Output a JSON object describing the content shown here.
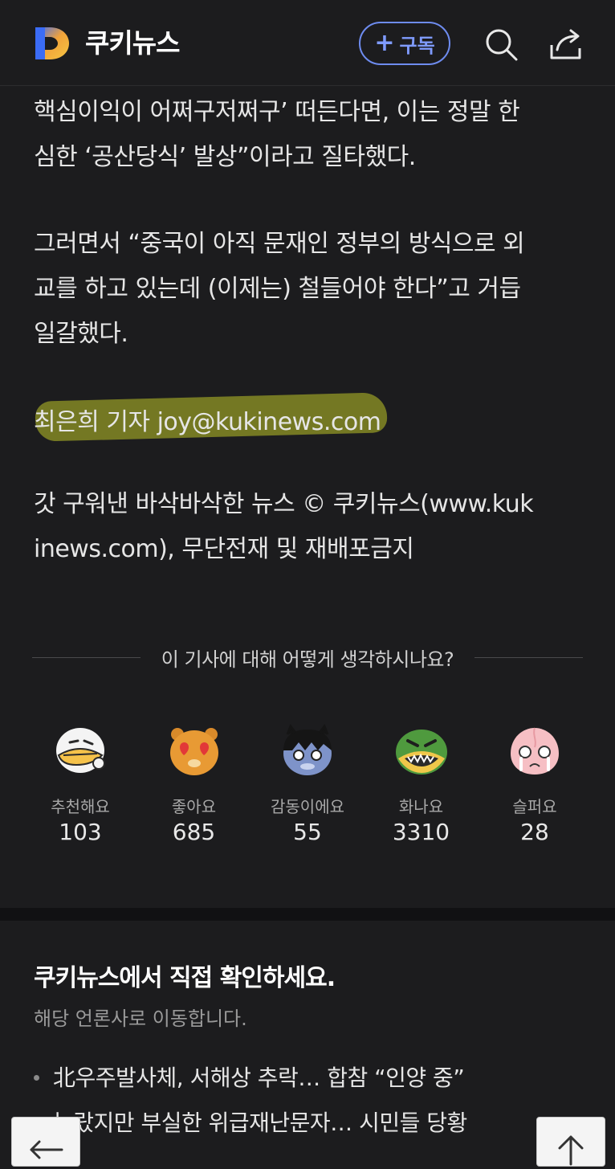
{
  "header": {
    "brand": "쿠키뉴스",
    "subscribe_label": "구독",
    "subscribe_plus": "+"
  },
  "article": {
    "paragraphs": [
      [
        "핵심이익이 어쩌구저쩌구’ 떠든다면, 이는 정말 한",
        "심한 ‘공산당식’ 발상”이라고 질타했다."
      ],
      [
        "그러면서 “중국이 아직 문재인 정부의 방식으로 외",
        "교를 하고 있는데 (이제는) 철들어야 한다”고 거듭",
        "일갈했다."
      ],
      [
        "최은희 기자 joy@kukinews.com"
      ],
      [
        "갓 구워낸 바삭바삭한 뉴스 © 쿠키뉴스(www.kuk",
        "inews.com), 무단전재 및 재배포금지"
      ]
    ]
  },
  "reactions": {
    "question": "이 기사에 대해 어떻게 생각하시나요?",
    "items": [
      {
        "label": "추천해요",
        "count": "103",
        "icon": "recommend-icon"
      },
      {
        "label": "좋아요",
        "count": "685",
        "icon": "like-icon"
      },
      {
        "label": "감동이에요",
        "count": "55",
        "icon": "touched-icon"
      },
      {
        "label": "화나요",
        "count": "3310",
        "icon": "angry-icon"
      },
      {
        "label": "슬퍼요",
        "count": "28",
        "icon": "sad-icon"
      }
    ]
  },
  "source": {
    "title": "쿠키뉴스에서 직접 확인하세요.",
    "subtitle": "해당 언론사로 이동합니다.",
    "news": [
      "北우주발사체, 서해상 추락… 합참 “인양 중”",
      "놀랐지만 부실한 위급재난문자… 시민들 당황"
    ]
  },
  "colors": {
    "background": "#1c1c1e",
    "accent": "#7f9bff",
    "highlight": "#bec428"
  }
}
